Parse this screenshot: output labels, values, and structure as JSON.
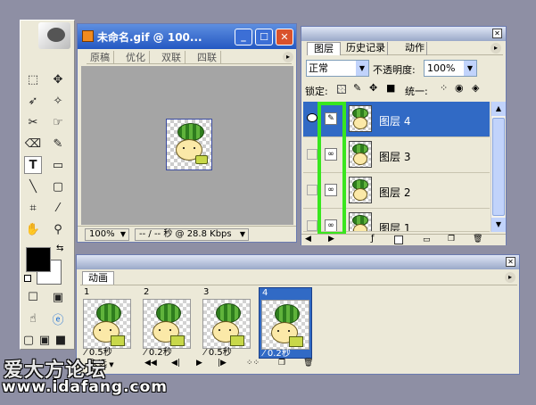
{
  "doc_window": {
    "title": "未命名.gif @ 100...",
    "tabs": [
      "原稿",
      "优化",
      "双联",
      "四联"
    ],
    "zoom": "100%",
    "status": "-- / -- 秒 @ 28.8 Kbps"
  },
  "layers_panel": {
    "tabs": [
      "图层",
      "历史记录",
      "动作"
    ],
    "blend_mode": "正常",
    "opacity_label": "不透明度:",
    "opacity_value": "100%",
    "lock_label": "锁定:",
    "unify_label": "统一:",
    "layers": [
      {
        "name": "图层 4",
        "selected": true
      },
      {
        "name": "图层 3",
        "selected": false
      },
      {
        "name": "图层 2",
        "selected": false
      },
      {
        "name": "图层 1",
        "selected": false
      }
    ]
  },
  "animation_panel": {
    "tab": "动画",
    "frames": [
      {
        "num": "1",
        "delay": "0.5秒"
      },
      {
        "num": "2",
        "delay": "0.2秒"
      },
      {
        "num": "3",
        "delay": "0.5秒"
      },
      {
        "num": "4",
        "delay": "0.2秒"
      }
    ],
    "loop": "永远"
  },
  "watermark": {
    "line1": "爱大方论坛",
    "line2": "www.idafang.com"
  },
  "colors": {
    "selection": "#316ac5",
    "highlight_box": "#39e61e",
    "title_active": "#316ac5"
  }
}
